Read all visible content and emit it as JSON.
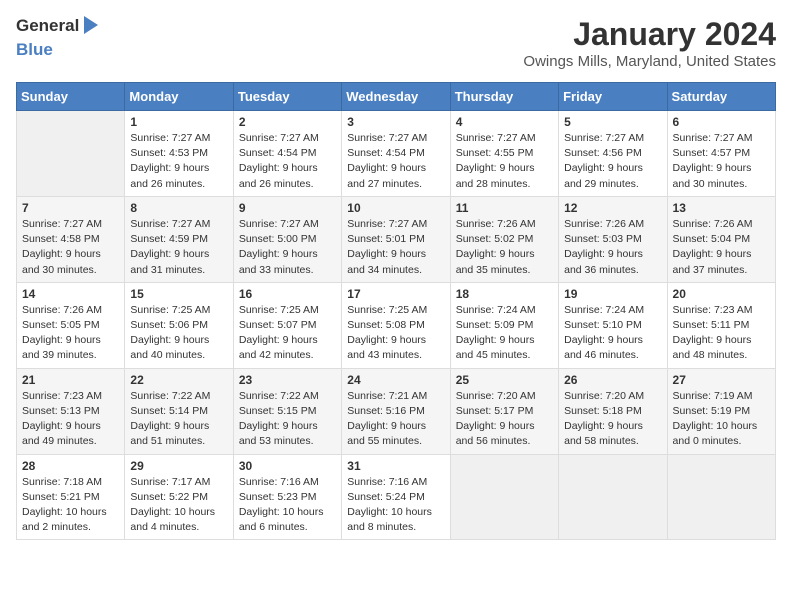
{
  "header": {
    "logo_line1": "General",
    "logo_line2": "Blue",
    "month_year": "January 2024",
    "location": "Owings Mills, Maryland, United States"
  },
  "weekdays": [
    "Sunday",
    "Monday",
    "Tuesday",
    "Wednesday",
    "Thursday",
    "Friday",
    "Saturday"
  ],
  "weeks": [
    [
      {
        "day": "",
        "sunrise": "",
        "sunset": "",
        "daylight": ""
      },
      {
        "day": "1",
        "sunrise": "Sunrise: 7:27 AM",
        "sunset": "Sunset: 4:53 PM",
        "daylight": "Daylight: 9 hours and 26 minutes."
      },
      {
        "day": "2",
        "sunrise": "Sunrise: 7:27 AM",
        "sunset": "Sunset: 4:54 PM",
        "daylight": "Daylight: 9 hours and 26 minutes."
      },
      {
        "day": "3",
        "sunrise": "Sunrise: 7:27 AM",
        "sunset": "Sunset: 4:54 PM",
        "daylight": "Daylight: 9 hours and 27 minutes."
      },
      {
        "day": "4",
        "sunrise": "Sunrise: 7:27 AM",
        "sunset": "Sunset: 4:55 PM",
        "daylight": "Daylight: 9 hours and 28 minutes."
      },
      {
        "day": "5",
        "sunrise": "Sunrise: 7:27 AM",
        "sunset": "Sunset: 4:56 PM",
        "daylight": "Daylight: 9 hours and 29 minutes."
      },
      {
        "day": "6",
        "sunrise": "Sunrise: 7:27 AM",
        "sunset": "Sunset: 4:57 PM",
        "daylight": "Daylight: 9 hours and 30 minutes."
      }
    ],
    [
      {
        "day": "7",
        "sunrise": "Sunrise: 7:27 AM",
        "sunset": "Sunset: 4:58 PM",
        "daylight": "Daylight: 9 hours and 30 minutes."
      },
      {
        "day": "8",
        "sunrise": "Sunrise: 7:27 AM",
        "sunset": "Sunset: 4:59 PM",
        "daylight": "Daylight: 9 hours and 31 minutes."
      },
      {
        "day": "9",
        "sunrise": "Sunrise: 7:27 AM",
        "sunset": "Sunset: 5:00 PM",
        "daylight": "Daylight: 9 hours and 33 minutes."
      },
      {
        "day": "10",
        "sunrise": "Sunrise: 7:27 AM",
        "sunset": "Sunset: 5:01 PM",
        "daylight": "Daylight: 9 hours and 34 minutes."
      },
      {
        "day": "11",
        "sunrise": "Sunrise: 7:26 AM",
        "sunset": "Sunset: 5:02 PM",
        "daylight": "Daylight: 9 hours and 35 minutes."
      },
      {
        "day": "12",
        "sunrise": "Sunrise: 7:26 AM",
        "sunset": "Sunset: 5:03 PM",
        "daylight": "Daylight: 9 hours and 36 minutes."
      },
      {
        "day": "13",
        "sunrise": "Sunrise: 7:26 AM",
        "sunset": "Sunset: 5:04 PM",
        "daylight": "Daylight: 9 hours and 37 minutes."
      }
    ],
    [
      {
        "day": "14",
        "sunrise": "Sunrise: 7:26 AM",
        "sunset": "Sunset: 5:05 PM",
        "daylight": "Daylight: 9 hours and 39 minutes."
      },
      {
        "day": "15",
        "sunrise": "Sunrise: 7:25 AM",
        "sunset": "Sunset: 5:06 PM",
        "daylight": "Daylight: 9 hours and 40 minutes."
      },
      {
        "day": "16",
        "sunrise": "Sunrise: 7:25 AM",
        "sunset": "Sunset: 5:07 PM",
        "daylight": "Daylight: 9 hours and 42 minutes."
      },
      {
        "day": "17",
        "sunrise": "Sunrise: 7:25 AM",
        "sunset": "Sunset: 5:08 PM",
        "daylight": "Daylight: 9 hours and 43 minutes."
      },
      {
        "day": "18",
        "sunrise": "Sunrise: 7:24 AM",
        "sunset": "Sunset: 5:09 PM",
        "daylight": "Daylight: 9 hours and 45 minutes."
      },
      {
        "day": "19",
        "sunrise": "Sunrise: 7:24 AM",
        "sunset": "Sunset: 5:10 PM",
        "daylight": "Daylight: 9 hours and 46 minutes."
      },
      {
        "day": "20",
        "sunrise": "Sunrise: 7:23 AM",
        "sunset": "Sunset: 5:11 PM",
        "daylight": "Daylight: 9 hours and 48 minutes."
      }
    ],
    [
      {
        "day": "21",
        "sunrise": "Sunrise: 7:23 AM",
        "sunset": "Sunset: 5:13 PM",
        "daylight": "Daylight: 9 hours and 49 minutes."
      },
      {
        "day": "22",
        "sunrise": "Sunrise: 7:22 AM",
        "sunset": "Sunset: 5:14 PM",
        "daylight": "Daylight: 9 hours and 51 minutes."
      },
      {
        "day": "23",
        "sunrise": "Sunrise: 7:22 AM",
        "sunset": "Sunset: 5:15 PM",
        "daylight": "Daylight: 9 hours and 53 minutes."
      },
      {
        "day": "24",
        "sunrise": "Sunrise: 7:21 AM",
        "sunset": "Sunset: 5:16 PM",
        "daylight": "Daylight: 9 hours and 55 minutes."
      },
      {
        "day": "25",
        "sunrise": "Sunrise: 7:20 AM",
        "sunset": "Sunset: 5:17 PM",
        "daylight": "Daylight: 9 hours and 56 minutes."
      },
      {
        "day": "26",
        "sunrise": "Sunrise: 7:20 AM",
        "sunset": "Sunset: 5:18 PM",
        "daylight": "Daylight: 9 hours and 58 minutes."
      },
      {
        "day": "27",
        "sunrise": "Sunrise: 7:19 AM",
        "sunset": "Sunset: 5:19 PM",
        "daylight": "Daylight: 10 hours and 0 minutes."
      }
    ],
    [
      {
        "day": "28",
        "sunrise": "Sunrise: 7:18 AM",
        "sunset": "Sunset: 5:21 PM",
        "daylight": "Daylight: 10 hours and 2 minutes."
      },
      {
        "day": "29",
        "sunrise": "Sunrise: 7:17 AM",
        "sunset": "Sunset: 5:22 PM",
        "daylight": "Daylight: 10 hours and 4 minutes."
      },
      {
        "day": "30",
        "sunrise": "Sunrise: 7:16 AM",
        "sunset": "Sunset: 5:23 PM",
        "daylight": "Daylight: 10 hours and 6 minutes."
      },
      {
        "day": "31",
        "sunrise": "Sunrise: 7:16 AM",
        "sunset": "Sunset: 5:24 PM",
        "daylight": "Daylight: 10 hours and 8 minutes."
      },
      {
        "day": "",
        "sunrise": "",
        "sunset": "",
        "daylight": ""
      },
      {
        "day": "",
        "sunrise": "",
        "sunset": "",
        "daylight": ""
      },
      {
        "day": "",
        "sunrise": "",
        "sunset": "",
        "daylight": ""
      }
    ]
  ]
}
